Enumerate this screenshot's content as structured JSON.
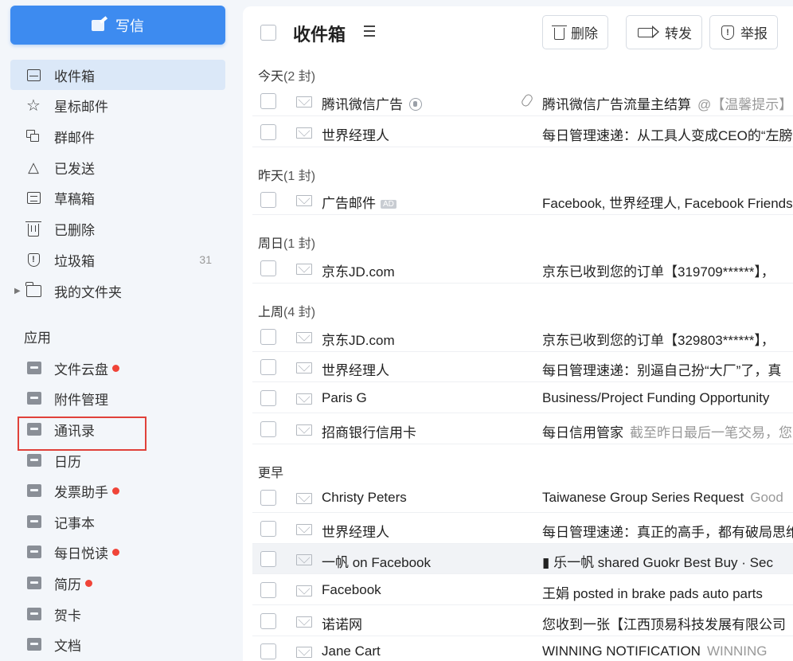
{
  "sidebar": {
    "compose_label": "写信",
    "nav": [
      {
        "label": "收件箱",
        "icon": "inbox-icon"
      },
      {
        "label": "星标邮件",
        "icon": "star-icon"
      },
      {
        "label": "群邮件",
        "icon": "group-mail-icon"
      },
      {
        "label": "已发送",
        "icon": "sent-icon"
      },
      {
        "label": "草稿箱",
        "icon": "draft-icon"
      },
      {
        "label": "已删除",
        "icon": "trash-icon"
      },
      {
        "label": "垃圾箱",
        "icon": "spam-icon",
        "count": "31"
      },
      {
        "label": "我的文件夹",
        "icon": "folder-icon"
      }
    ],
    "apps_title": "应用",
    "apps": [
      {
        "label": "文件云盘",
        "icon": "cloud-drive-icon",
        "dot": true
      },
      {
        "label": "附件管理",
        "icon": "attachment-manager-icon",
        "dot": false
      },
      {
        "label": "通讯录",
        "icon": "contacts-icon",
        "dot": false
      },
      {
        "label": "日历",
        "icon": "calendar-icon",
        "dot": false
      },
      {
        "label": "发票助手",
        "icon": "invoice-icon",
        "dot": true
      },
      {
        "label": "记事本",
        "icon": "notepad-icon",
        "dot": false
      },
      {
        "label": "每日悦读",
        "icon": "daily-read-icon",
        "dot": true
      },
      {
        "label": "简历",
        "icon": "resume-icon",
        "dot": true
      },
      {
        "label": "贺卡",
        "icon": "greeting-card-icon",
        "dot": false
      },
      {
        "label": "文档",
        "icon": "document-icon",
        "dot": false
      }
    ],
    "spam_symbol": "!",
    "app_dot_color": "#f04438"
  },
  "toolbar": {
    "title": "收件箱",
    "delete_label": "删除",
    "forward_label": "转发",
    "report_label": "举报",
    "report_symbol": "!"
  },
  "groups": [
    {
      "label": "今天",
      "count": "(2 封)"
    },
    {
      "label": "昨天",
      "count": "(1 封)"
    },
    {
      "label": "周日",
      "count": "(1 封)"
    },
    {
      "label": "上周",
      "count": "(4 封)"
    },
    {
      "label": "更早",
      "count": ""
    }
  ],
  "emails": [
    {
      "sender": "腾讯微信广告",
      "subject": "腾讯微信广告流量主结算",
      "preview": "@【温馨提示】",
      "attachment": true,
      "sender_icon": true
    },
    {
      "sender": "世界经理人",
      "subject": "每日管理速递：从工具人变成CEO的“左膀右臂”",
      "preview": ""
    },
    {
      "sender": "广告邮件",
      "tag": "AD",
      "subject": "Facebook, 世界经理人, Facebook Friends",
      "preview": ""
    },
    {
      "sender": "京东JD.com",
      "subject": "京东已收到您的订单【319709******】，",
      "preview": ""
    },
    {
      "sender": "京东JD.com",
      "subject": "京东已收到您的订单【329803******】，",
      "preview": ""
    },
    {
      "sender": "世界经理人",
      "subject": "每日管理速递：别逼自己扮“大厂”了，真",
      "preview": ""
    },
    {
      "sender": "Paris G",
      "subject": "Business/Project Funding Opportunity",
      "preview": ""
    },
    {
      "sender": "招商银行信用卡",
      "subject": "每日信用管家",
      "preview": "截至昨日最后一笔交易，您"
    },
    {
      "sender": "Christy Peters",
      "subject": "Taiwanese Group Series Request",
      "preview": "Good"
    },
    {
      "sender": "世界经理人",
      "subject": "每日管理速递：真正的高手，都有破局思维",
      "preview": ""
    },
    {
      "sender": "一帆 on Facebook",
      "subject": "▮ 乐一帆 shared Guokr Best Buy · Sec",
      "preview": ""
    },
    {
      "sender": "Facebook",
      "subject": "王娟 posted in brake pads auto parts",
      "preview": ""
    },
    {
      "sender": "诺诺网",
      "subject": "您收到一张【江西顶易科技发展有限公司",
      "preview": ""
    },
    {
      "sender": "Jane Cart",
      "subject": "WINNING NOTIFICATION",
      "preview": "WINNING"
    }
  ],
  "colors": {
    "compose_bg": "#3d8bf0",
    "active_nav_bg": "#dbe8f8",
    "highlight_border": "#e0413a",
    "unread_dot": "#f04438"
  }
}
